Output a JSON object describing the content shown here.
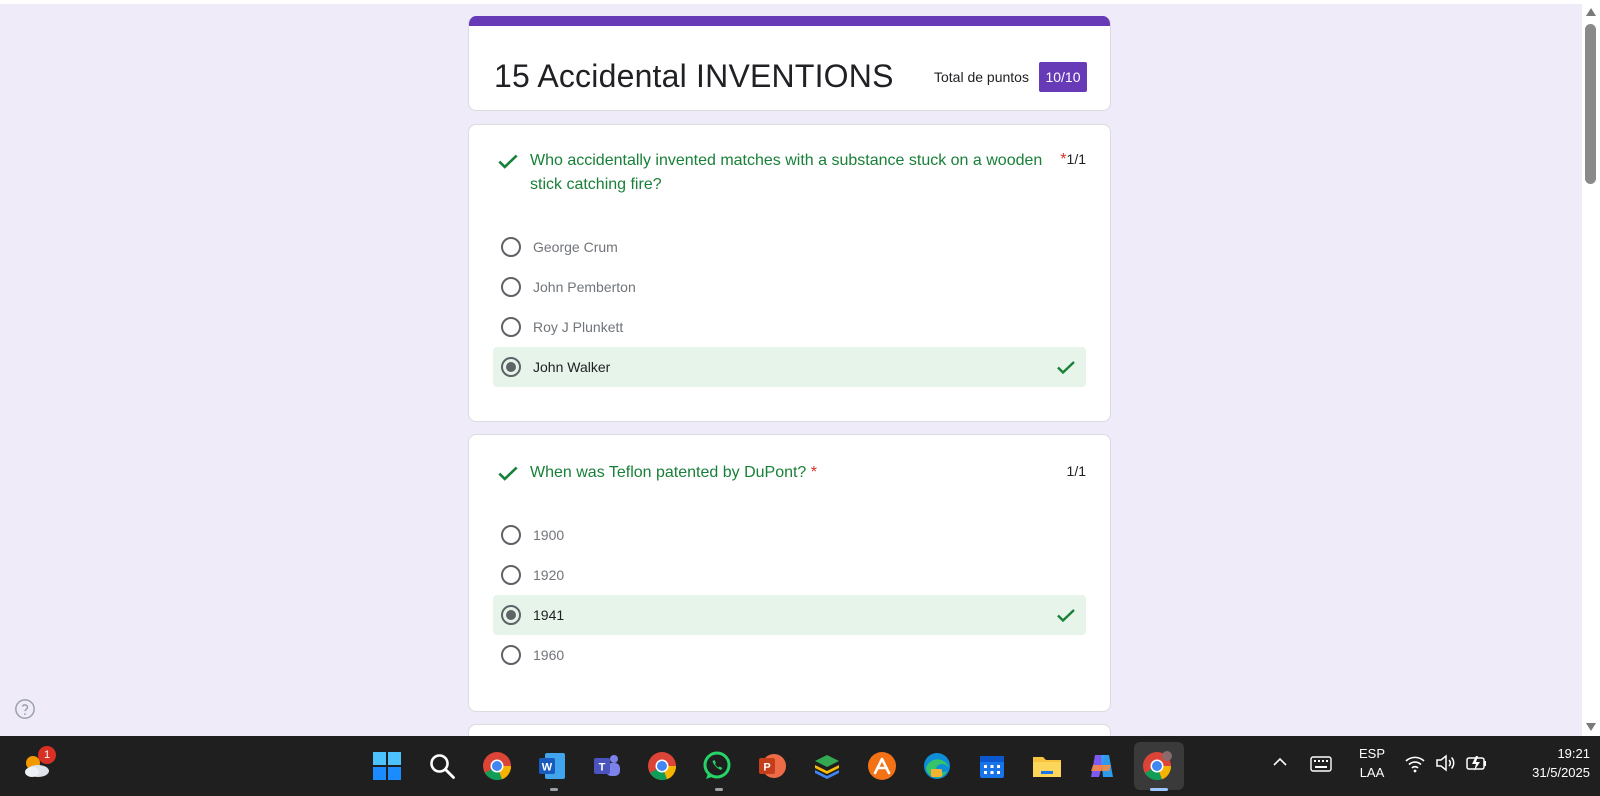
{
  "form": {
    "title": "15 Accidental INVENTIONS",
    "points_label": "Total de puntos",
    "points_value": "10/10",
    "accent_color": "#673ab7",
    "correct_color": "#188038",
    "required_mark": "*"
  },
  "questions": [
    {
      "text": "Who accidentally invented matches with a substance stuck on a wooden stick catching fire?",
      "score": "1/1",
      "options": [
        {
          "label": "George Crum",
          "selected": false,
          "correct": false
        },
        {
          "label": "John Pemberton",
          "selected": false,
          "correct": false
        },
        {
          "label": "Roy J Plunkett",
          "selected": false,
          "correct": false
        },
        {
          "label": "John Walker",
          "selected": true,
          "correct": true
        }
      ]
    },
    {
      "text": "When was Teflon patented by DuPont?",
      "score": "1/1",
      "options": [
        {
          "label": "1900",
          "selected": false,
          "correct": false
        },
        {
          "label": "1920",
          "selected": false,
          "correct": false
        },
        {
          "label": "1941",
          "selected": true,
          "correct": true
        },
        {
          "label": "1960",
          "selected": false,
          "correct": false
        }
      ]
    }
  ],
  "taskbar": {
    "weather_badge": "1",
    "apps": [
      "windows-start-icon",
      "search-icon",
      "chrome-icon",
      "word-icon",
      "teams-icon",
      "chrome-icon",
      "whatsapp-icon",
      "powerpoint-icon",
      "stack-app-icon",
      "arrow-app-icon",
      "edge-icon",
      "calendar-icon",
      "file-explorer-icon",
      "copilot-icon",
      "chrome-active-icon"
    ],
    "lang_line1": "ESP",
    "lang_line2": "LAA",
    "time": "19:21",
    "date": "31/5/2025"
  }
}
